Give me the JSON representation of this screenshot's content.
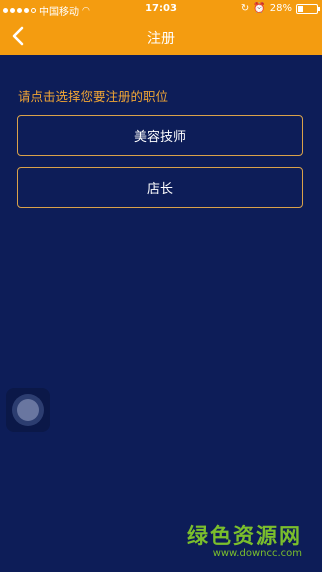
{
  "status_bar": {
    "carrier": "中国移动",
    "time": "17:03",
    "battery": "28%",
    "battery_level": 0.28
  },
  "nav": {
    "title": "注册",
    "back_icon": "chevron-left-icon"
  },
  "main": {
    "prompt": "请点击选择您要注册的职位",
    "options": [
      {
        "label": "美容技师"
      },
      {
        "label": "店长"
      }
    ]
  },
  "watermark": {
    "text": "绿色资源网",
    "url": "www.downcc.com"
  },
  "colors": {
    "accent": "#f49c10",
    "background": "#0d1d58",
    "prompt": "#f1a534",
    "border": "#d9a24a"
  }
}
